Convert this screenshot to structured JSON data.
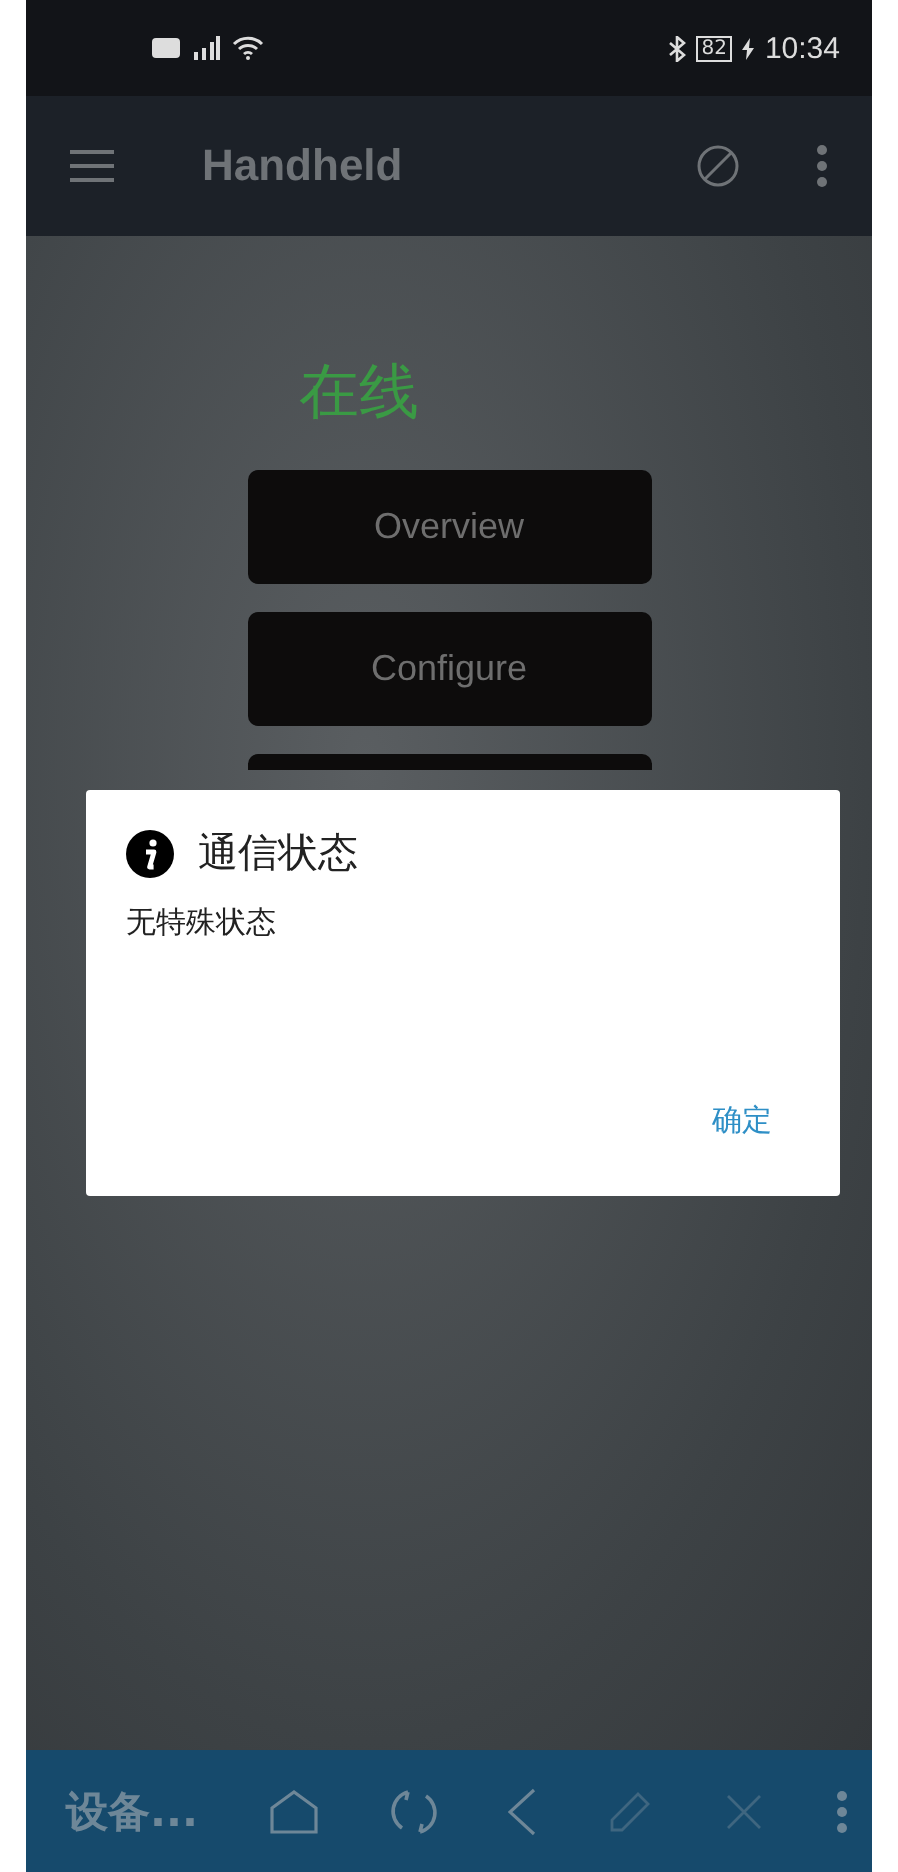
{
  "status_bar": {
    "battery": "82",
    "time": "10:34"
  },
  "app_bar": {
    "title": "Handheld"
  },
  "status_text": "在线",
  "menu_buttons": [
    {
      "label": "Overview"
    },
    {
      "label": "Configure"
    },
    {
      "covered": true
    }
  ],
  "dialog": {
    "title": "通信状态",
    "message": "无特殊状态",
    "ok_button": "确定"
  },
  "bottom_bar": {
    "title": "设备...",
    "tools": [
      {
        "kind": "home",
        "disabled": false
      },
      {
        "kind": "refresh",
        "disabled": false
      },
      {
        "kind": "back",
        "disabled": false
      },
      {
        "kind": "edit",
        "disabled": true
      },
      {
        "kind": "close",
        "disabled": true
      },
      {
        "kind": "more",
        "disabled": false
      }
    ]
  }
}
